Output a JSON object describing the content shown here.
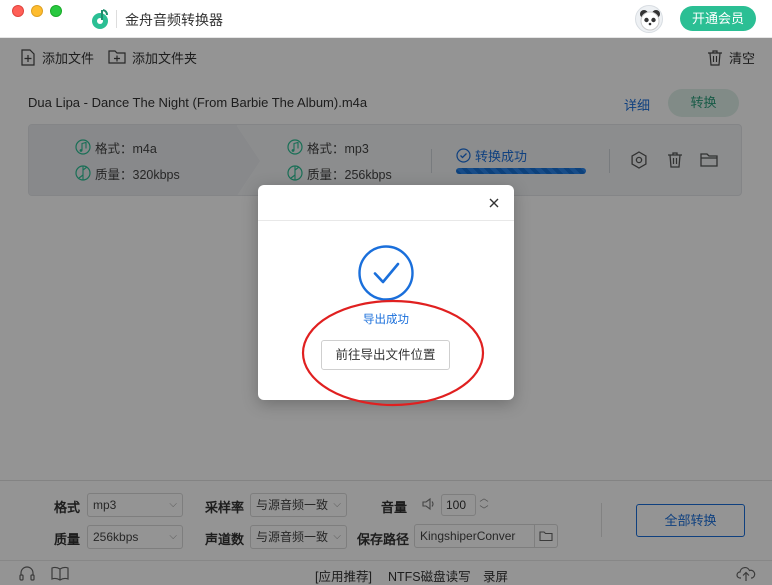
{
  "window": {
    "title": "金舟音频转换器",
    "vip_button": "开通会员"
  },
  "toolbar": {
    "add_file": "添加文件",
    "add_folder": "添加文件夹",
    "clear": "清空"
  },
  "file": {
    "name": "Dua Lipa - Dance The Night (From Barbie The Album).m4a",
    "detail_link": "详细",
    "convert_button": "转换",
    "source": {
      "format": "格式：m4a",
      "quality": "质量：320kbps"
    },
    "target": {
      "format": "格式：mp3",
      "quality": "质量：256kbps"
    },
    "status": "转换成功",
    "progress_fraction": 1.0
  },
  "dialog": {
    "message": "导出成功",
    "goto_button": "前往导出文件位置"
  },
  "settings": {
    "format_label": "格式",
    "format_value": "mp3",
    "quality_label": "质量",
    "quality_value": "256kbps",
    "sample_rate_label": "采样率",
    "sample_rate_value": "与源音频一致",
    "channels_label": "声道数",
    "channels_value": "与源音频一致",
    "volume_label": "音量",
    "volume_value": "100",
    "save_path_label": "保存路径",
    "save_path_value": "KingshiperConver",
    "convert_all_button": "全部转换"
  },
  "statusbar": {
    "app_recommend": "[应用推荐]",
    "ntfs": "NTFS磁盘读写",
    "record": "录屏"
  },
  "colors": {
    "accent_green": "#2bbf94",
    "link_blue": "#1a6fdb",
    "annotation_red": "#e02020"
  }
}
